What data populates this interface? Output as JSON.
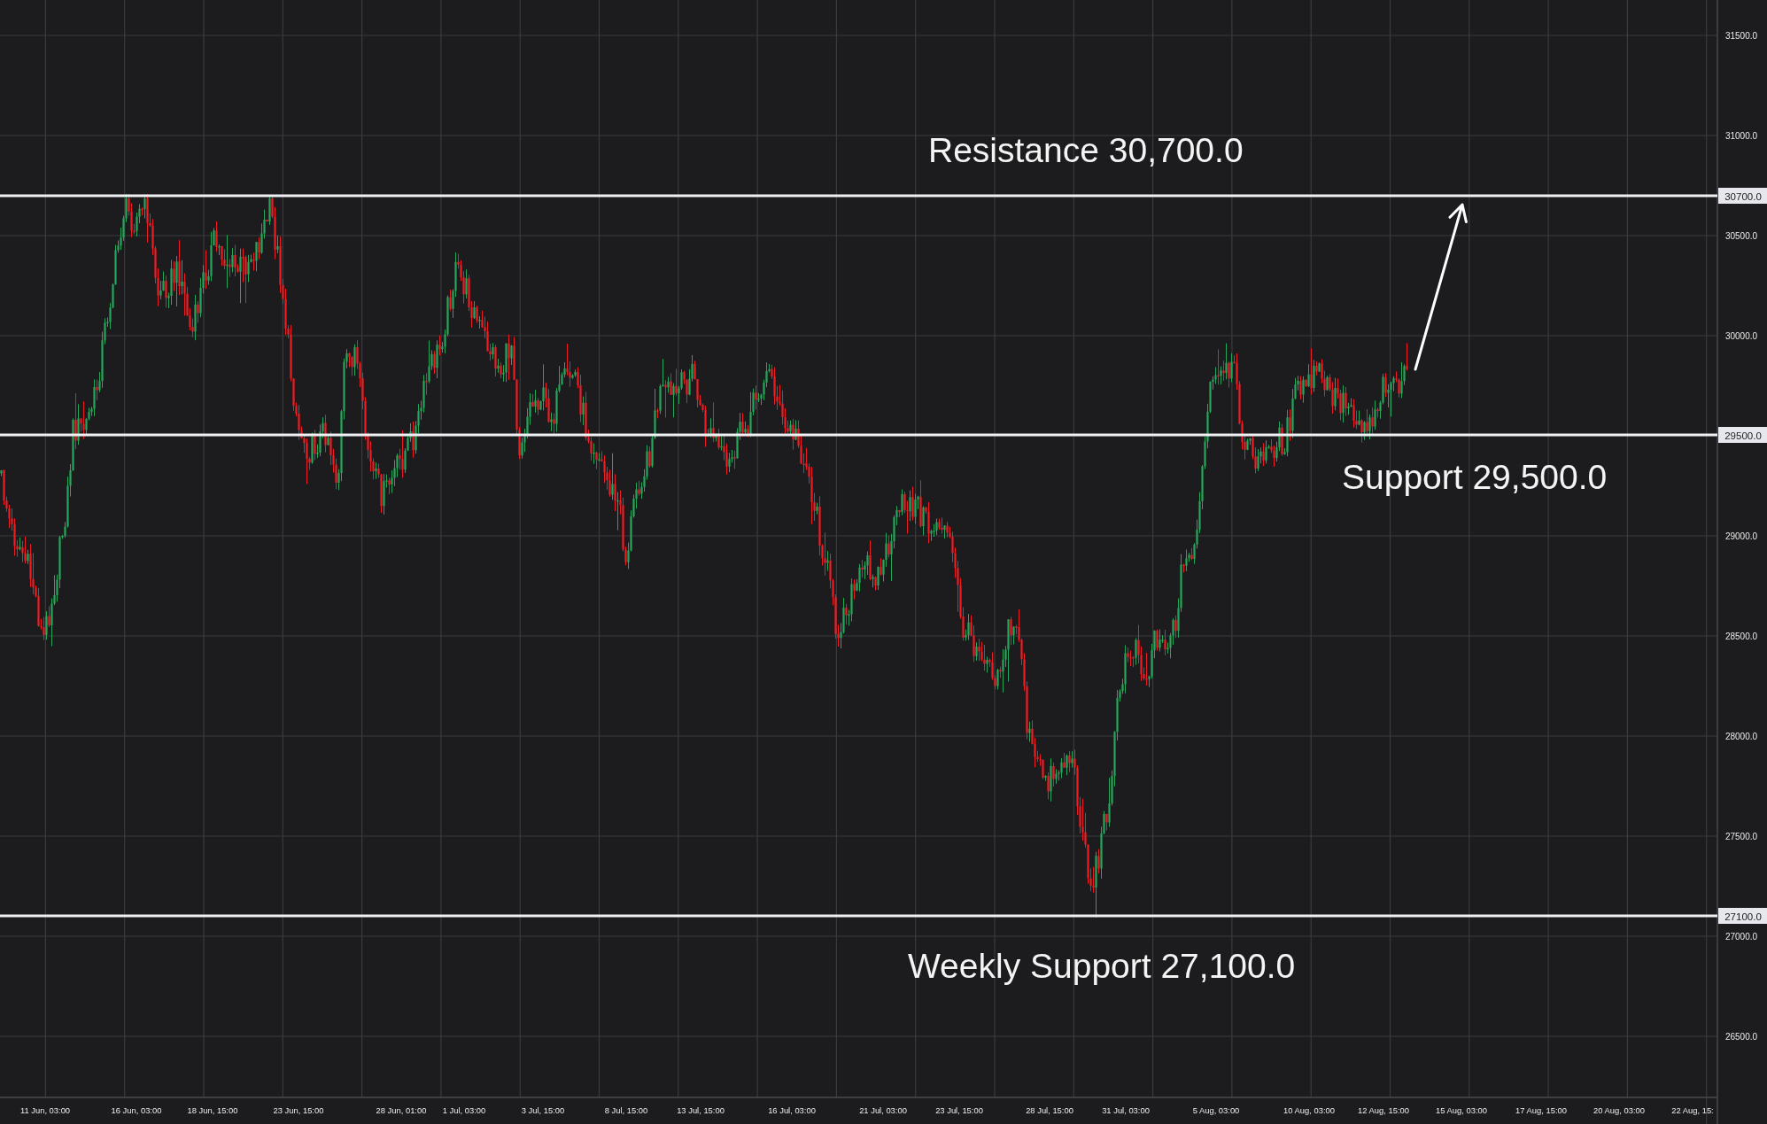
{
  "chart": {
    "levels": [
      {
        "label": "Resistance 30,700.0",
        "price_tag": "30700.0"
      },
      {
        "label": "Support 29,500.0",
        "price_tag": "29500.0"
      },
      {
        "label": "Weekly Support 27,100.0",
        "price_tag": "27100.0"
      }
    ],
    "y_axis": {
      "ticks": [
        "31500.0",
        "31000.0",
        "30500.0",
        "30000.0",
        "29000.0",
        "28500.0",
        "28000.0",
        "27500.0",
        "27000.0",
        "26500.0"
      ]
    },
    "x_axis": {
      "ticks": [
        "11 Jun, 03:00",
        "16 Jun, 03:00",
        "18 Jun, 15:00",
        "23 Jun, 15:00",
        "28 Jun, 01:00",
        "1 Jul, 03:00",
        "3 Jul, 15:00",
        "8 Jul, 15:00",
        "13 Jul, 15:00",
        "16 Jul, 03:00",
        "21 Jul, 03:00",
        "23 Jul, 15:00",
        "28 Jul, 15:00",
        "31 Jul, 03:00",
        "5 Aug, 03:00",
        "10 Aug, 03:00",
        "12 Aug, 15:00",
        "15 Aug, 03:00",
        "17 Aug, 15:00",
        "20 Aug, 03:00",
        "22 Aug, 15:"
      ]
    }
  }
}
